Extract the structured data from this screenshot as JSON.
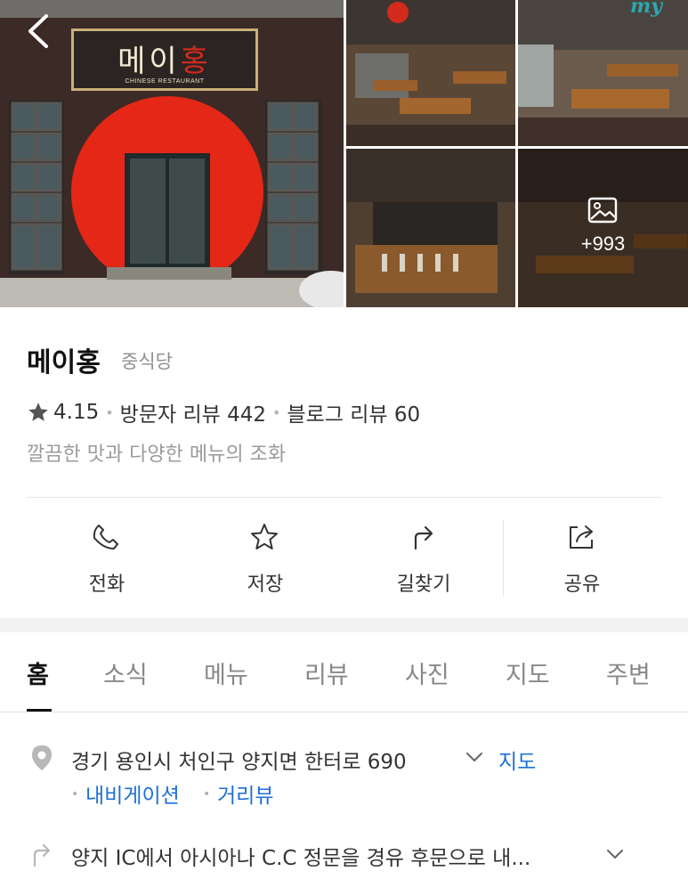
{
  "gallery": {
    "sign_name_part1": "메이",
    "sign_name_part2": "홍",
    "sign_subtitle": "CHINESE RESTAURANT",
    "more_photos_count": "+993",
    "my_badge": "my"
  },
  "place": {
    "name": "메이홍",
    "category": "중식당",
    "rating": "4.15",
    "visitor_reviews": "방문자 리뷰 442",
    "blog_reviews": "블로그 리뷰 60",
    "description": "깔끔한 맛과 다양한 메뉴의 조화"
  },
  "actions": {
    "call": "전화",
    "save": "저장",
    "directions": "길찾기",
    "share": "공유"
  },
  "tabs": {
    "home": "홈",
    "news": "소식",
    "menu": "메뉴",
    "review": "리뷰",
    "photo": "사진",
    "map": "지도",
    "nearby": "주변"
  },
  "address": {
    "text": "경기 용인시 처인구 양지면 한터로 690",
    "map_link": "지도",
    "navigation_link": "내비게이션",
    "streetview_link": "거리뷰"
  },
  "directions_note": "양지 IC에서 아시아나 C.C 정문을 경유 후문으로 내...",
  "colors": {
    "link_blue": "#1d6fd8",
    "muted_gray": "#9a9a9a",
    "band_gray": "#f2f2f2"
  }
}
